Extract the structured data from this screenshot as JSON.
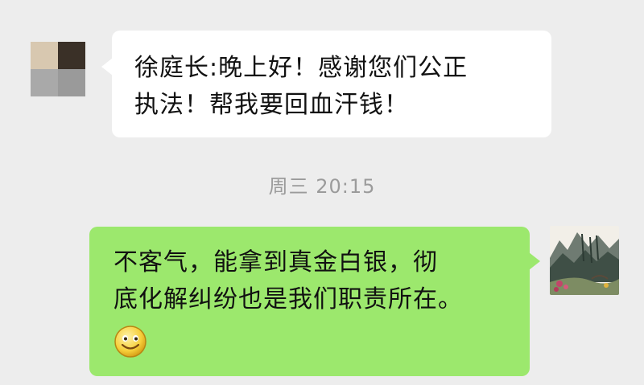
{
  "conversation": {
    "incoming": {
      "sender": "徐庭长",
      "text": "徐庭长:晚上好！感谢您们公正\n执法！帮我要回血汗钱！",
      "avatar_icon": "pixelated-avatar-icon",
      "avatar_colors": [
        "#d8c8b0",
        "#3a3027",
        "#a9a9a9",
        "#9a9a9a"
      ]
    },
    "timestamp": "周三 20:15",
    "outgoing": {
      "text": "不客气，能拿到真金白银，彻\n底化解纠纷也是我们职责所在。",
      "emoji_icon": "smile-emoji-icon",
      "avatar_icon": "landscape-painting-avatar-icon"
    }
  },
  "colors": {
    "background": "#ededed",
    "incoming_bubble": "#ffffff",
    "outgoing_bubble": "#9ce86d",
    "timestamp_text": "#9b9b9b"
  }
}
